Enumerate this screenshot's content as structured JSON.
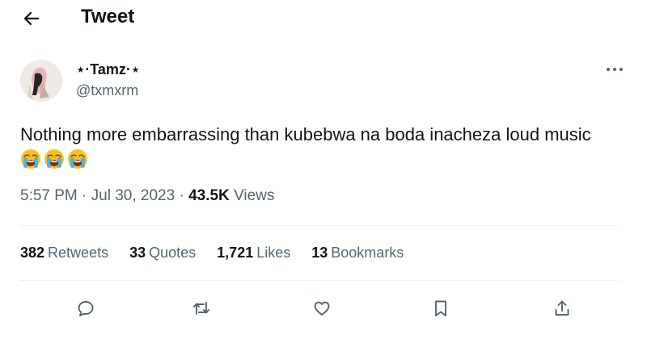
{
  "header": {
    "title": "Tweet",
    "back_icon": "arrow-left-icon"
  },
  "author": {
    "display_name": "⋆·Tamz·⋆",
    "handle": "@txmxrm",
    "avatar": "profile-photo"
  },
  "tweet": {
    "text": "Nothing more embarrassing than kubebwa na boda inacheza loud music",
    "emojis": [
      "😭",
      "😭",
      "😭"
    ],
    "emoji_icon": "loudly-crying-face-icon"
  },
  "meta": {
    "time": "5:57 PM",
    "separator": "·",
    "date": "Jul 30, 2023",
    "views_count": "43.5K",
    "views_label": "Views"
  },
  "stats": {
    "retweets": {
      "count": "382",
      "label": "Retweets"
    },
    "quotes": {
      "count": "33",
      "label": "Quotes"
    },
    "likes": {
      "count": "1,721",
      "label": "Likes"
    },
    "bookmarks": {
      "count": "13",
      "label": "Bookmarks"
    }
  },
  "actions": [
    "reply-icon",
    "retweet-icon",
    "like-icon",
    "bookmark-icon",
    "share-icon"
  ],
  "colors": {
    "text": "#0f1419",
    "secondary": "#536471",
    "divider": "#eff3f4",
    "icon": "#536471"
  }
}
